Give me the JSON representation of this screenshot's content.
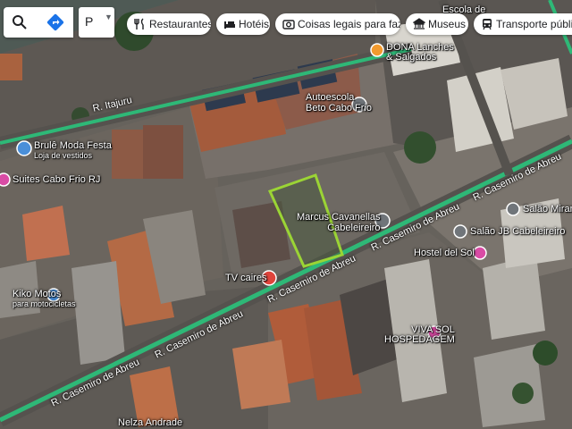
{
  "toolbar": {
    "layer_value": "P",
    "chips": [
      {
        "label": "Restaurantes",
        "icon": "restaurant-icon"
      },
      {
        "label": "Hotéis",
        "icon": "hotel-icon"
      },
      {
        "label": "Coisas legais para fazer",
        "icon": "camera-icon"
      },
      {
        "label": "Museus",
        "icon": "museum-icon"
      },
      {
        "label": "Transporte público",
        "icon": "transit-icon"
      }
    ]
  },
  "places": {
    "dona": "DONA Lanches",
    "dona_sub": "& Salgados",
    "autoescola_1": "Autoescola",
    "autoescola_2": "Beto Cabo Frio",
    "brule": "Brulê Moda Festa",
    "brule_sub": "Loja de vestidos",
    "suites": "Suites Cabo Frio RJ",
    "marcus_1": "Marcus Cavanellas",
    "marcus_2": "Cabeleireiro",
    "salao_miranda": "Salão Miranda",
    "salao_jb": "Salão JB Cabeleireiro",
    "hostel": "Hostel del Sol",
    "tv_caires": "TV caires",
    "kiko": "Kiko Motos",
    "kiko_sub": "para motocicletas",
    "viva_sol_1": "VIVA SOL",
    "viva_sol_2": "HOSPEDAGEM",
    "escola": "Escola de",
    "nelza": "Nelza Andrade"
  },
  "roads": {
    "itajuru": "R. Itajuru",
    "casemiro_1": "R. Casemiro de Abreu",
    "casemiro_2": "R. Casemiro de Abreu",
    "casemiro_3": "R. Casemiro de Abreu",
    "casemiro_4": "R. Casemiro de Abreu",
    "casemiro_5": "R. Casemiro de Abreu"
  },
  "colors": {
    "highlight": "#9bd435",
    "road": "#2eb877",
    "pin_blue": "#4a8fd9",
    "pin_red": "#e0443c",
    "pin_pink": "#d94ca5",
    "pin_orange": "#f29a2e",
    "pin_gray": "#70757a"
  }
}
